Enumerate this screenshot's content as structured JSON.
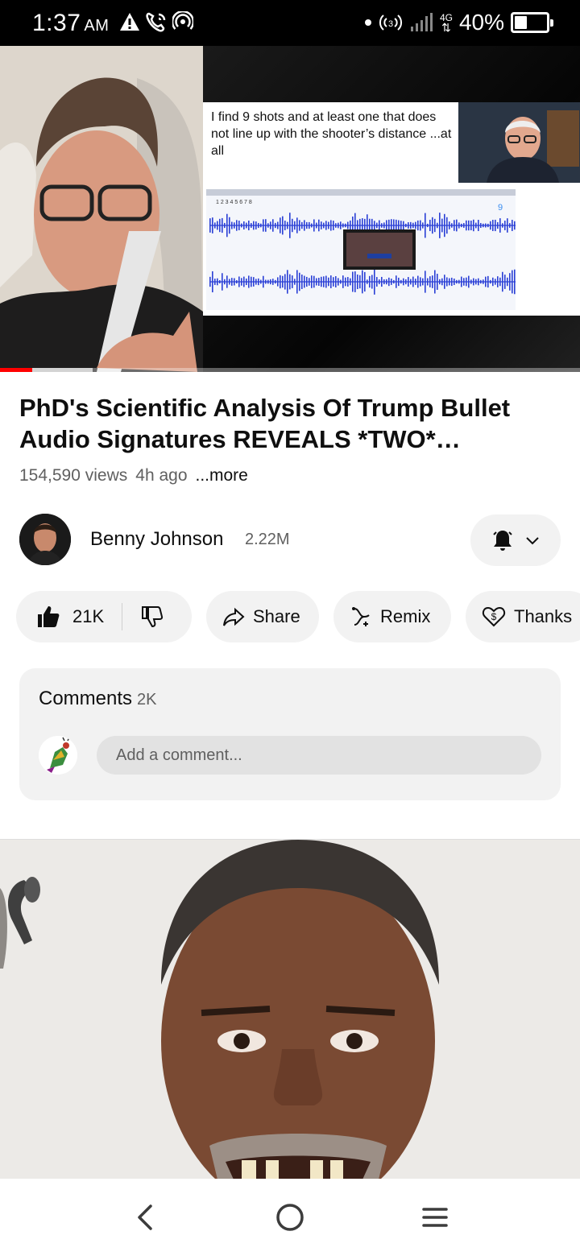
{
  "status_bar": {
    "time": "1:37",
    "ampm": "AM",
    "network": "4G",
    "battery_percent": "40%",
    "battery_level": 0.4,
    "icons": [
      "warning-icon",
      "wifi-calling-icon",
      "hotspot-icon",
      "dot-icon",
      "hotspot-signal-icon",
      "signal-icon",
      "battery-icon"
    ]
  },
  "video": {
    "slide_text": "I find 9 shots and at least one that does not line up with the shooter’s distance ...at all",
    "wave_marker_top": "1  2  3        4 5 6 7   8",
    "wave_number": "9",
    "progress": 0.055,
    "buffered_to": 0.16
  },
  "title": "PhD's Scientific Analysis Of Trump Bullet Audio Signatures REVEALS *TWO* SHOOTERS",
  "meta": {
    "views": "154,590 views",
    "age": "4h ago",
    "more": "...more"
  },
  "channel": {
    "name": "Benny Johnson",
    "subscribers": "2.22M"
  },
  "actions": {
    "likes": "21K",
    "share": "Share",
    "remix": "Remix",
    "thanks": "Thanks"
  },
  "comments": {
    "label": "Comments",
    "count": "2K",
    "placeholder": "Add a comment..."
  },
  "navigation": [
    "back-icon",
    "home-icon",
    "recents-icon"
  ]
}
